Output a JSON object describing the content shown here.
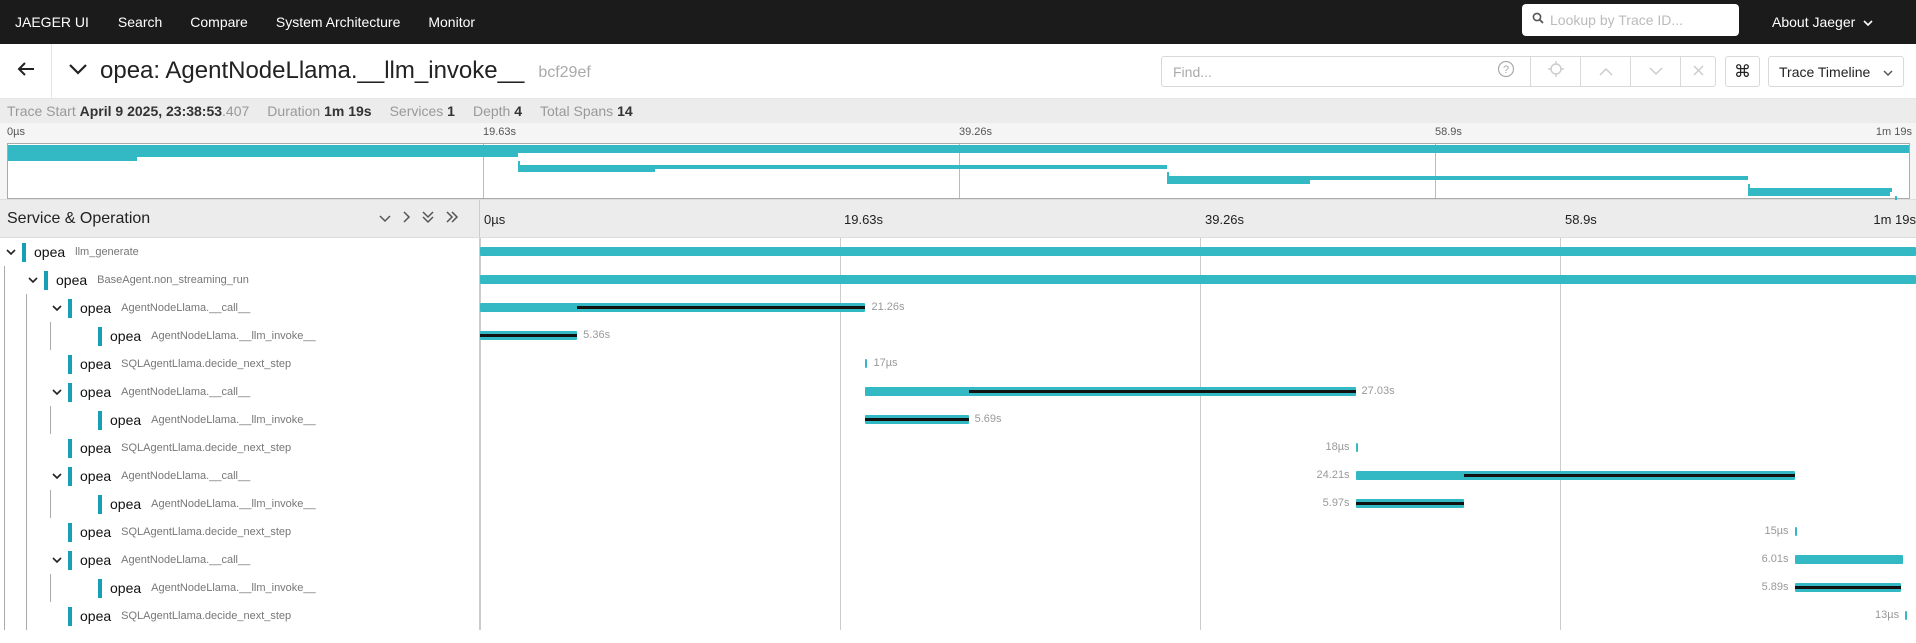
{
  "nav": {
    "brand": "JAEGER UI",
    "links": [
      "Search",
      "Compare",
      "System Architecture",
      "Monitor"
    ],
    "lookup_placeholder": "Lookup by Trace ID...",
    "about": "About Jaeger"
  },
  "trace": {
    "title": "opea: AgentNodeLlama.__llm_invoke__",
    "id": "bcf29ef",
    "find_placeholder": "Find...",
    "view": "Trace Timeline"
  },
  "stats": {
    "start_label": "Trace Start",
    "start_value": "April 9 2025, 23:38:53",
    "start_ms": ".407",
    "duration_label": "Duration",
    "duration_value": "1m 19s",
    "services_label": "Services",
    "services_value": "1",
    "depth_label": "Depth",
    "depth_value": "4",
    "spans_label": "Total Spans",
    "spans_value": "14"
  },
  "ticks": [
    "0µs",
    "19.63s",
    "39.26s",
    "58.9s",
    "1m 19s"
  ],
  "timeline": {
    "header": "Service & Operation",
    "total_seconds": 79.2
  },
  "colors": {
    "span": "#32b9c4",
    "service": "#17a0b5",
    "nav_bg": "#1b1b1b"
  },
  "spans": [
    {
      "service": "opea",
      "op": "llm_generate",
      "depth": 0,
      "collapsible": true,
      "start": 0,
      "dur": 79.2,
      "self_from": null,
      "label": ""
    },
    {
      "service": "opea",
      "op": "BaseAgent.non_streaming_run",
      "depth": 1,
      "collapsible": true,
      "start": 0,
      "dur": 79.2,
      "self_from": null,
      "label": ""
    },
    {
      "service": "opea",
      "op": "AgentNodeLlama.__call__",
      "depth": 2,
      "collapsible": true,
      "start": 0,
      "dur": 21.26,
      "self_from": 5.36,
      "label": "21.26s"
    },
    {
      "service": "opea",
      "op": "AgentNodeLlama.__llm_invoke__",
      "depth": 3,
      "collapsible": false,
      "start": 0,
      "dur": 5.36,
      "self_from": 0,
      "label": "5.36s"
    },
    {
      "service": "opea",
      "op": "SQLAgentLlama.decide_next_step",
      "depth": 2,
      "collapsible": false,
      "start": 21.26,
      "dur": 2e-05,
      "self_from": null,
      "label": "17µs"
    },
    {
      "service": "opea",
      "op": "AgentNodeLlama.__call__",
      "depth": 2,
      "collapsible": true,
      "start": 21.26,
      "dur": 27.03,
      "self_from": 26.95,
      "label": "27.03s"
    },
    {
      "service": "opea",
      "op": "AgentNodeLlama.__llm_invoke__",
      "depth": 3,
      "collapsible": false,
      "start": 21.26,
      "dur": 5.69,
      "self_from": 21.26,
      "label": "5.69s"
    },
    {
      "service": "opea",
      "op": "SQLAgentLlama.decide_next_step",
      "depth": 2,
      "collapsible": false,
      "start": 48.29,
      "dur": 2e-05,
      "self_from": null,
      "label": "18µs",
      "label_left": true
    },
    {
      "service": "opea",
      "op": "AgentNodeLlama.__call__",
      "depth": 2,
      "collapsible": true,
      "start": 48.29,
      "dur": 24.21,
      "self_from": 54.26,
      "label": "24.21s",
      "label_left": true
    },
    {
      "service": "opea",
      "op": "AgentNodeLlama.__llm_invoke__",
      "depth": 3,
      "collapsible": false,
      "start": 48.29,
      "dur": 5.97,
      "self_from": 48.29,
      "label": "5.97s",
      "label_left": true
    },
    {
      "service": "opea",
      "op": "SQLAgentLlama.decide_next_step",
      "depth": 2,
      "collapsible": false,
      "start": 72.5,
      "dur": 2e-05,
      "self_from": null,
      "label": "15µs",
      "label_left": true
    },
    {
      "service": "opea",
      "op": "AgentNodeLlama.__call__",
      "depth": 2,
      "collapsible": true,
      "start": 72.5,
      "dur": 6.01,
      "self_from": null,
      "label": "6.01s",
      "label_left": true
    },
    {
      "service": "opea",
      "op": "AgentNodeLlama.__llm_invoke__",
      "depth": 3,
      "collapsible": false,
      "start": 72.5,
      "dur": 5.89,
      "self_from": 72.5,
      "label": "5.89s",
      "label_left": true
    },
    {
      "service": "opea",
      "op": "SQLAgentLlama.decide_next_step",
      "depth": 2,
      "collapsible": false,
      "start": 78.6,
      "dur": 2e-05,
      "self_from": null,
      "label": "13µs",
      "label_left": true
    }
  ]
}
